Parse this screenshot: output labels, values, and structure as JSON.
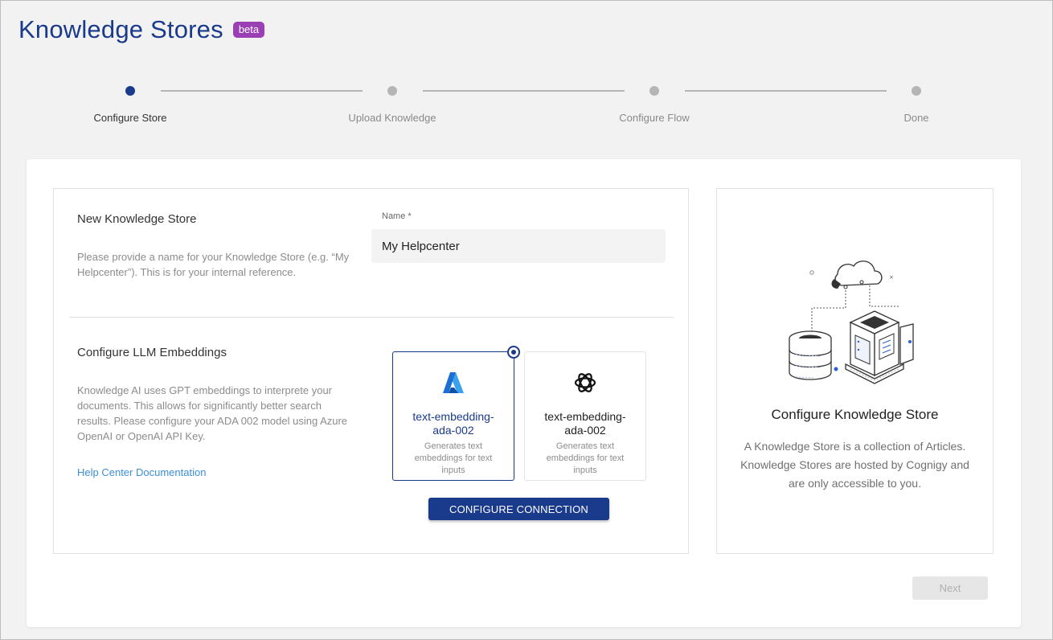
{
  "header": {
    "title": "Knowledge Stores",
    "badge": "beta"
  },
  "stepper": {
    "steps": [
      {
        "label": "Configure Store",
        "active": true
      },
      {
        "label": "Upload Knowledge",
        "active": false
      },
      {
        "label": "Configure Flow",
        "active": false
      },
      {
        "label": "Done",
        "active": false
      }
    ]
  },
  "store_section": {
    "title": "New Knowledge Store",
    "description": "Please provide a name for your Knowledge Store (e.g. “My Helpcenter”). This is for your internal reference.",
    "name_label": "Name *",
    "name_value": "My Helpcenter"
  },
  "embeddings_section": {
    "title": "Configure LLM Embeddings",
    "description": "Knowledge AI uses GPT embeddings to interprete your documents. This allows for significantly better search results. Please configure your ADA 002 model using Azure OpenAI or OpenAI API Key.",
    "help_link": "Help Center Documentation",
    "models": [
      {
        "provider_icon": "azure-icon",
        "name": "text-embedding-ada-002",
        "description": "Generates text embeddings for text inputs",
        "selected": true
      },
      {
        "provider_icon": "openai-icon",
        "name": "text-embedding-ada-002",
        "description": "Generates text embeddings for text inputs",
        "selected": false
      }
    ],
    "configure_button": "CONFIGURE CONNECTION"
  },
  "info_panel": {
    "title": "Configure Knowledge Store",
    "description": "A Knowledge Store is a collection of Articles. Knowledge Stores are hosted by Cognigy and are only accessible to you."
  },
  "footer": {
    "next_button": "Next"
  },
  "colors": {
    "primary": "#1a3a8c",
    "badge": "#9b3fb5",
    "link": "#3d8fd6"
  }
}
